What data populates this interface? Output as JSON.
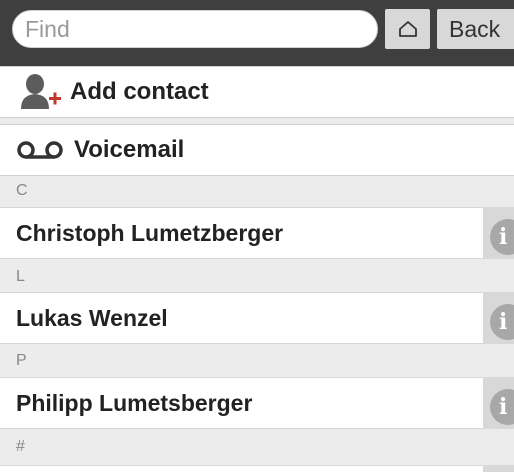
{
  "search": {
    "placeholder": "Find"
  },
  "toolbar": {
    "home_icon": "home-icon",
    "back_label": "Back"
  },
  "actions": {
    "add_contact": {
      "label": "Add contact",
      "icon": "add-contact-icon"
    },
    "voicemail": {
      "label": "Voicemail",
      "icon": "voicemail-icon"
    }
  },
  "sections": [
    {
      "letter": "C",
      "contacts": [
        {
          "name": "Christoph Lumetzberger"
        }
      ]
    },
    {
      "letter": "L",
      "contacts": [
        {
          "name": "Lukas Wenzel"
        }
      ]
    },
    {
      "letter": "P",
      "contacts": [
        {
          "name": "Philipp Lumetsberger"
        }
      ]
    },
    {
      "letter": "#",
      "contacts": []
    }
  ],
  "info_glyph": "i",
  "colors": {
    "accent": "#c0392b",
    "topbar": "#3f3f3f"
  }
}
